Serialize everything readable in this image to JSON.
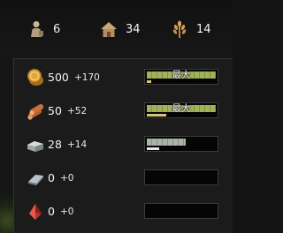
{
  "topbar": {
    "population": {
      "icon": "worker-icon",
      "value": "6"
    },
    "houses": {
      "icon": "house-icon",
      "value": "34"
    },
    "food": {
      "icon": "wheat-icon",
      "value": "14"
    }
  },
  "resources": [
    {
      "id": "gold",
      "icon": "gold-coin-icon",
      "amount": "500",
      "rate": "+170",
      "bar_level": 1.0,
      "lower_level": 0.06,
      "max_label": "最大",
      "bar_color": "#9fb25a"
    },
    {
      "id": "wood",
      "icon": "wood-logs-icon",
      "amount": "50",
      "rate": "+52",
      "bar_level": 1.0,
      "lower_level": 0.28,
      "max_label": "最大",
      "bar_color": "#9fb25a"
    },
    {
      "id": "stone",
      "icon": "stone-block-icon",
      "amount": "28",
      "rate": "+14",
      "bar_level": 0.56,
      "lower_level": 0.18,
      "max_label": "",
      "bar_color": "#a9b3a6"
    },
    {
      "id": "iron",
      "icon": "iron-ingot-icon",
      "amount": "0",
      "rate": "+0",
      "bar_level": 0.0,
      "lower_level": 0.0,
      "max_label": "",
      "bar_color": "#a9b3a6"
    },
    {
      "id": "crystal",
      "icon": "red-crystal-icon",
      "amount": "0",
      "rate": "+0",
      "bar_level": 0.0,
      "lower_level": 0.0,
      "max_label": "",
      "bar_color": "#a9b3a6"
    }
  ]
}
